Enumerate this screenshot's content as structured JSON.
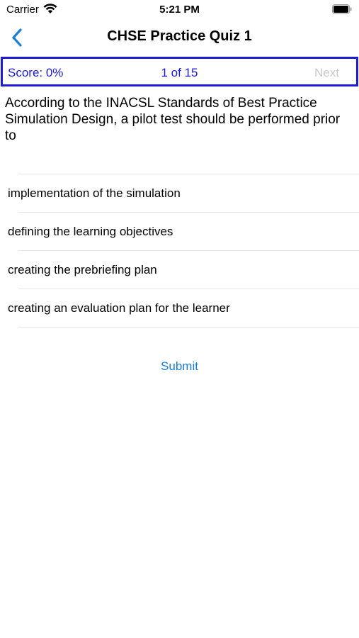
{
  "status": {
    "carrier": "Carrier",
    "time": "5:21 PM"
  },
  "nav": {
    "title": "CHSE Practice Quiz 1",
    "back_icon": "chevron-left-icon"
  },
  "quiz_bar": {
    "score": "Score: 0%",
    "progress": "1 of 15",
    "next": "Next"
  },
  "question": "According to the INACSL Standards of Best Practice Simulation Design, a pilot test should be performed prior to",
  "answers": [
    "implementation of the simulation",
    "defining the learning objectives",
    "creating the prebriefing plan",
    "creating an evaluation plan for the learner"
  ],
  "submit": "Submit",
  "colors": {
    "accent": "#1a7fd6",
    "score_border": "#1c1cd6",
    "disabled": "#c8c8c8"
  }
}
